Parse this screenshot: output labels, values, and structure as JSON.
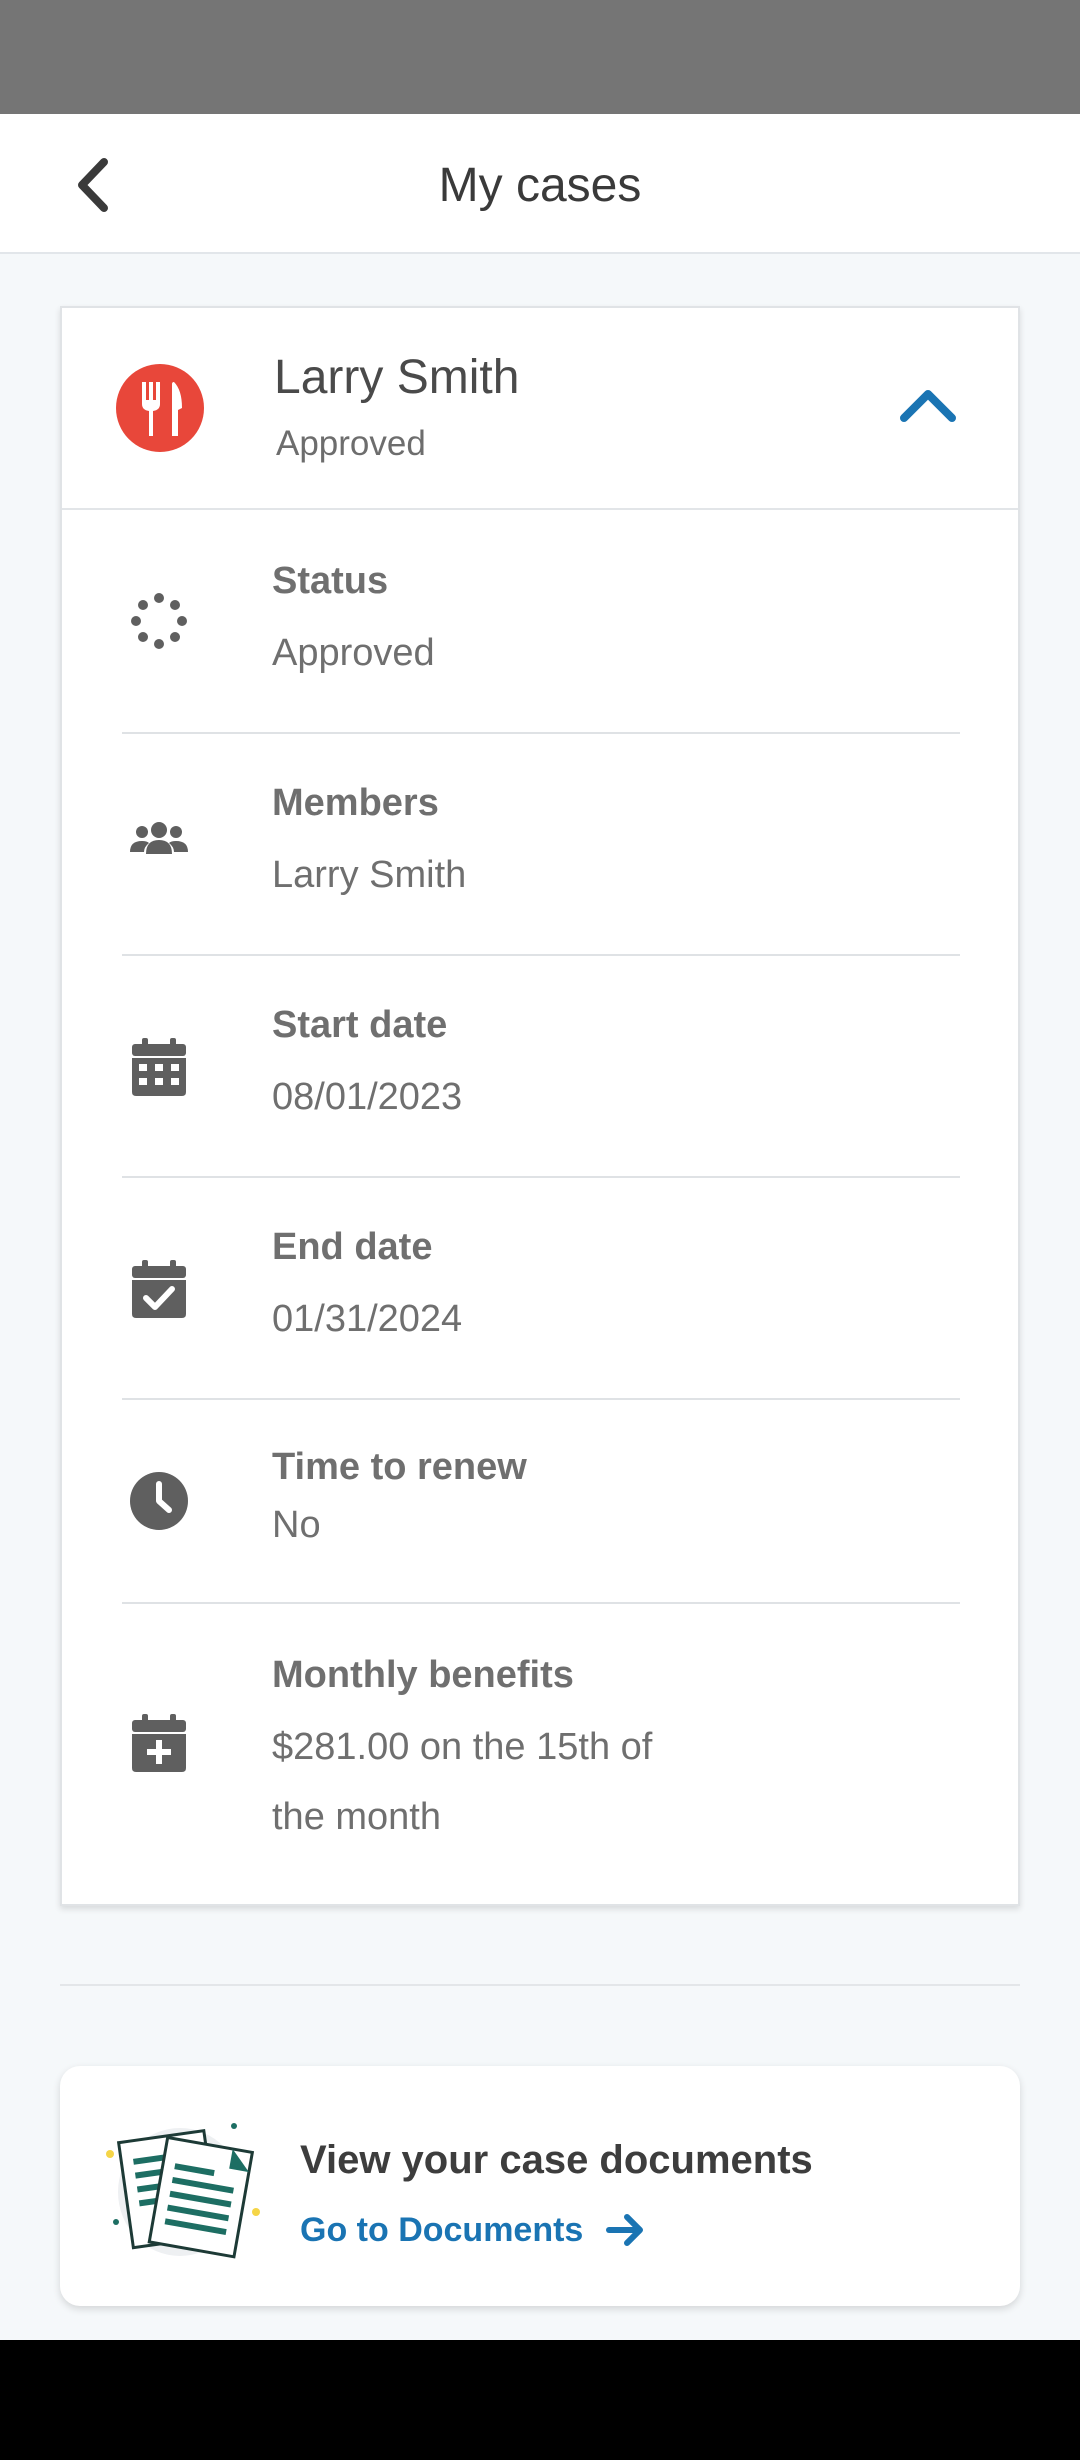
{
  "header": {
    "title": "My cases",
    "back_icon": "chevron-left-icon"
  },
  "case": {
    "name": "Larry Smith",
    "status": "Approved",
    "program_icon": "fork-knife-icon",
    "program_icon_color": "#e8473a",
    "collapse_icon": "chevron-up-icon",
    "accent_color": "#1a74b3",
    "details": {
      "status": {
        "label": "Status",
        "value": "Approved",
        "icon": "loading-dots-icon"
      },
      "members": {
        "label": "Members",
        "value": "Larry Smith",
        "icon": "users-icon"
      },
      "start_date": {
        "label": "Start date",
        "value": "08/01/2023",
        "icon": "calendar-icon"
      },
      "end_date": {
        "label": "End date",
        "value": "01/31/2024",
        "icon": "calendar-check-icon"
      },
      "time_to_renew": {
        "label": "Time to renew",
        "value": "No",
        "icon": "clock-icon"
      },
      "monthly_benefits": {
        "label": "Monthly benefits",
        "value_line1": "$281.00 on the 15th of",
        "value_line2": "the month",
        "icon": "calendar-plus-icon"
      }
    }
  },
  "documents": {
    "title": "View your case documents",
    "link_label": "Go to Documents",
    "illustration": "documents-illustration",
    "arrow_icon": "arrow-right-icon"
  }
}
